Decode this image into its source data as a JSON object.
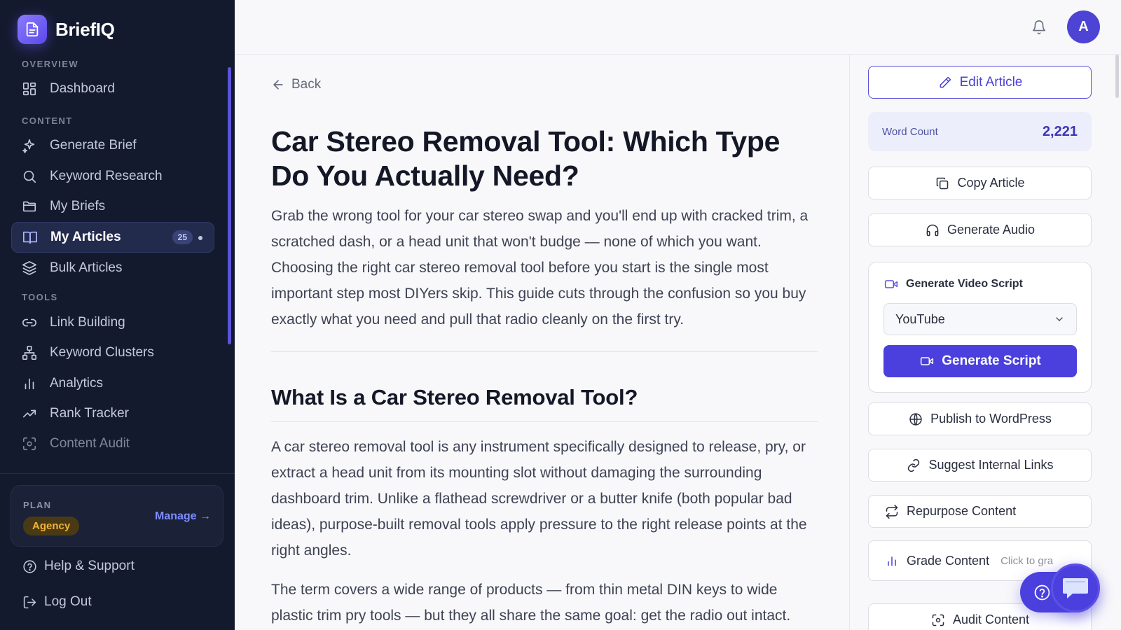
{
  "app": {
    "name": "BriefIQ"
  },
  "sidebar": {
    "sections": {
      "overview": "OVERVIEW",
      "content": "CONTENT",
      "tools": "TOOLS"
    },
    "items": [
      {
        "label": "Dashboard",
        "icon": "dashboard-icon"
      },
      {
        "label": "Generate Brief",
        "icon": "sparkle-icon"
      },
      {
        "label": "Keyword Research",
        "icon": "search-icon"
      },
      {
        "label": "My Briefs",
        "icon": "folder-icon"
      },
      {
        "label": "My Articles",
        "icon": "book-open-icon",
        "count": "25",
        "active": true
      },
      {
        "label": "Bulk Articles",
        "icon": "layers-icon"
      },
      {
        "label": "Link Building",
        "icon": "link-icon"
      },
      {
        "label": "Keyword Clusters",
        "icon": "cluster-icon"
      },
      {
        "label": "Analytics",
        "icon": "bar-chart-icon"
      },
      {
        "label": "Rank Tracker",
        "icon": "trending-up-icon"
      },
      {
        "label": "Content Audit",
        "icon": "scan-icon"
      }
    ],
    "plan": {
      "label": "PLAN",
      "tier": "Agency",
      "manage": "Manage →"
    },
    "help": "Help & Support",
    "logout": "Log Out"
  },
  "header": {
    "avatar_initial": "A"
  },
  "article": {
    "back": "Back",
    "title": "Car Stereo Removal Tool: Which Type Do You Actually Need?",
    "intro": "Grab the wrong tool for your car stereo swap and you'll end up with cracked trim, a scratched dash, or a head unit that won't budge — none of which you want. Choosing the right car stereo removal tool before you start is the single most important step most DIYers skip. This guide cuts through the confusion so you buy exactly what you need and pull that radio cleanly on the first try.",
    "h2": "What Is a Car Stereo Removal Tool?",
    "p1": "A car stereo removal tool is any instrument specifically designed to release, pry, or extract a head unit from its mounting slot without damaging the surrounding dashboard trim. Unlike a flathead screwdriver or a butter knife (both popular bad ideas), purpose-built removal tools apply pressure to the right release points at the right angles.",
    "p2": "The term covers a wide range of products — from thin metal DIN keys to wide plastic trim pry tools — but they all share the same goal: get the radio out intact."
  },
  "panel": {
    "edit": "Edit Article",
    "word_count_label": "Word Count",
    "word_count_value": "2,221",
    "copy": "Copy Article",
    "audio": "Generate Audio",
    "video": {
      "title": "Generate Video Script",
      "selected": "YouTube",
      "button": "Generate Script"
    },
    "publish": "Publish to WordPress",
    "links": "Suggest Internal Links",
    "repurpose": "Repurpose Content",
    "grade": "Grade Content",
    "grade_hint": "Click to gra",
    "audit": "Audit Content"
  },
  "colors": {
    "accent": "#4b40dd",
    "sidebar_bg": "#141a2e",
    "plan_badge": "#f0b43c"
  }
}
